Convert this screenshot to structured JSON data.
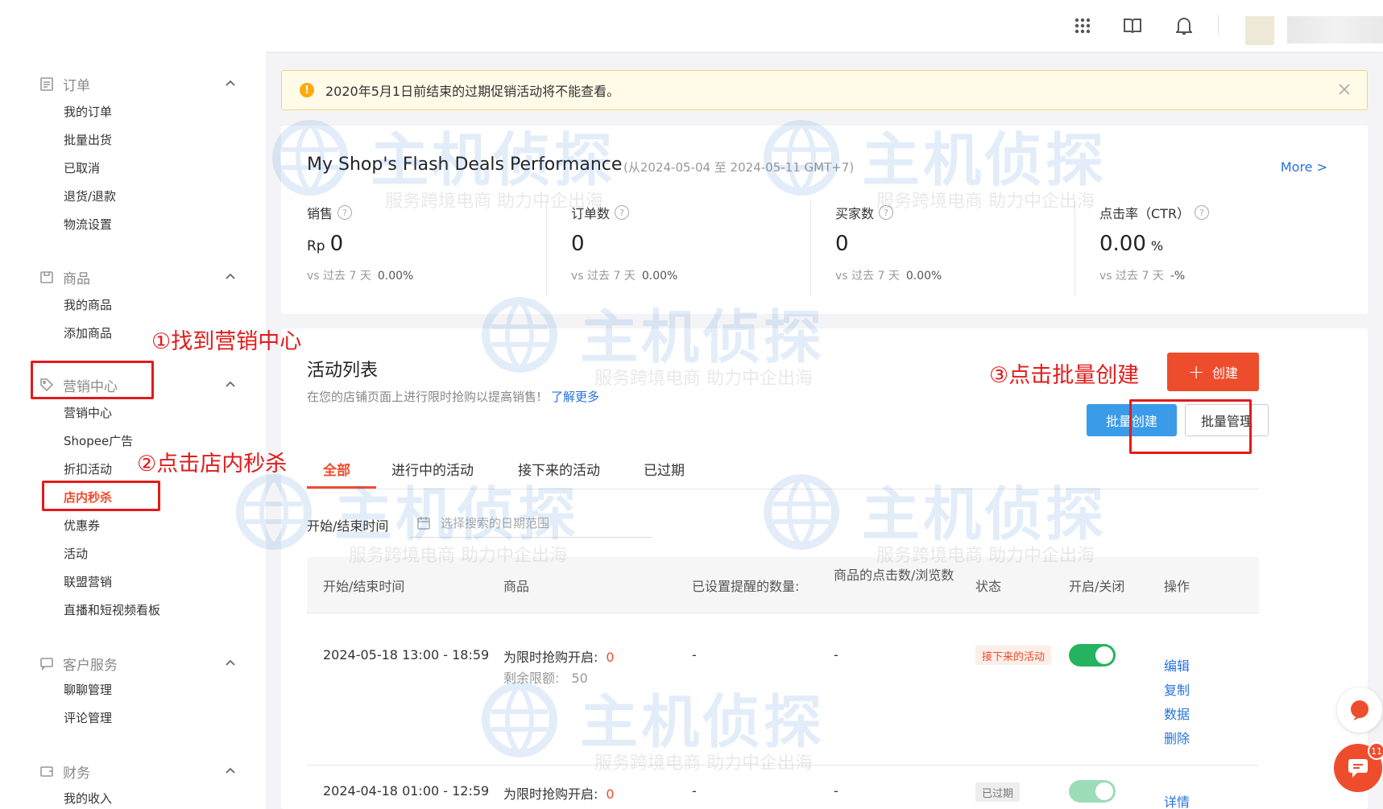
{
  "sidebar": {
    "sections": [
      {
        "title": "订单",
        "icon": "clipboard-icon",
        "items": [
          "我的订单",
          "批量出货",
          "已取消",
          "退货/退款",
          "物流设置"
        ]
      },
      {
        "title": "商品",
        "icon": "box-icon",
        "items": [
          "我的商品",
          "添加商品"
        ]
      },
      {
        "title": "营销中心",
        "icon": "tag-icon",
        "items": [
          "营销中心",
          "Shopee广告",
          "折扣活动",
          "店内秒杀",
          "优惠券",
          "活动",
          "联盟营销",
          "直播和短视频看板"
        ]
      },
      {
        "title": "客户服务",
        "icon": "chat-icon",
        "items": [
          "聊聊管理",
          "评论管理"
        ]
      },
      {
        "title": "财务",
        "icon": "wallet-icon",
        "items": [
          "我的收入"
        ]
      }
    ]
  },
  "annotations": {
    "step1": "①找到营销中心",
    "step2": "②点击店内秒杀",
    "step3": "③点击批量创建"
  },
  "notice": {
    "text": "2020年5月1日前结束的过期促销活动将不能查看。"
  },
  "performance": {
    "title": "My Shop's Flash Deals Performance",
    "range": "(从2024-05-04 至 2024-05-11 GMT+7)",
    "more": "More >",
    "metrics": [
      {
        "label": "销售",
        "unit": "Rp",
        "value": "0",
        "suffix": "",
        "cmp_label": "vs 过去 7 天",
        "cmp_value": "0.00%"
      },
      {
        "label": "订单数",
        "unit": "",
        "value": "0",
        "suffix": "",
        "cmp_label": "vs 过去 7 天",
        "cmp_value": "0.00%"
      },
      {
        "label": "买家数",
        "unit": "",
        "value": "0",
        "suffix": "",
        "cmp_label": "vs 过去 7 天",
        "cmp_value": "0.00%"
      },
      {
        "label": "点击率（CTR）",
        "unit": "",
        "value": "0.00",
        "suffix": "%",
        "cmp_label": "vs 过去 7 天",
        "cmp_value": "-%"
      }
    ]
  },
  "activity": {
    "title": "活动列表",
    "subtitle": "在您的店铺页面上进行限时抢购以提高销售!",
    "learn_more": "了解更多",
    "create_label": "创建",
    "batch_create_label": "批量创建",
    "batch_manage_label": "批量管理",
    "tabs": [
      "全部",
      "进行中的活动",
      "接下来的活动",
      "已过期"
    ],
    "filter_label": "开始/结束时间",
    "filter_placeholder": "选择搜索的日期范围",
    "columns": [
      "开始/结束时间",
      "商品",
      "已设置提醒的数量:",
      "商品的点击数/浏览数",
      "状态",
      "开启/关闭",
      "操作"
    ],
    "rows": [
      {
        "time": "2024-05-18 13:00 - 18:59",
        "enabled_label": "为限时抢购开启:",
        "enabled_value": "0",
        "remaining_label": "剩余限额:",
        "remaining_value": "50",
        "reminders": "-",
        "clicks": "-",
        "status": "接下来的活动",
        "actions": [
          "编辑",
          "复制",
          "数据",
          "删除"
        ]
      },
      {
        "time": "2024-04-18 01:00 - 12:59",
        "enabled_label": "为限时抢购开启:",
        "enabled_value": "0",
        "reminders": "-",
        "clicks": "-",
        "status": "已过期",
        "actions": [
          "详情"
        ]
      }
    ]
  },
  "watermark": {
    "main": "主机侦探",
    "sub": "服务跨境电商 助力中企出海"
  },
  "chat_badge": "11",
  "colors": {
    "brand": "#ee4d2d",
    "link": "#2673dd",
    "primary_button": "#3a9be9",
    "toggle_on": "#26b360",
    "annotation": "#e21b1b"
  }
}
